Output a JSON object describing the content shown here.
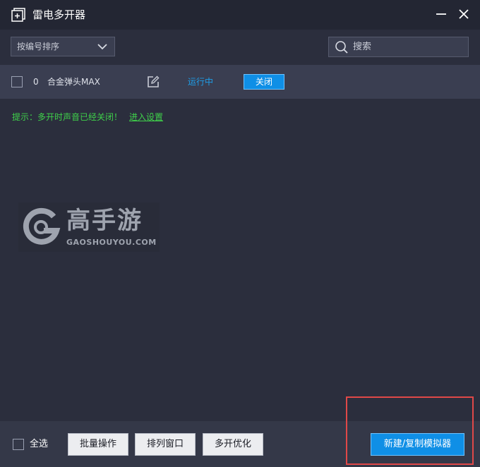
{
  "window": {
    "title": "雷电多开器",
    "icons": {
      "app": "new-window-icon",
      "minimize": "minimize-icon",
      "close": "close-icon"
    }
  },
  "toolbar": {
    "sort_select": {
      "value": "按编号排序",
      "icon": "chevron-down-icon"
    },
    "search": {
      "placeholder": "搜索",
      "icon": "search-icon"
    }
  },
  "instances": [
    {
      "index": "0",
      "name": "合金弹头MAX",
      "status": "运行中",
      "action_label": "关闭",
      "edit_icon": "edit-icon"
    }
  ],
  "hint": {
    "text": "提示：多开时声音已经关闭！",
    "link": "进入设置"
  },
  "watermark": {
    "cn": "高手游",
    "en": "GAOSHOUYOU.COM"
  },
  "footer": {
    "select_all": "全选",
    "batch_button": "批量操作",
    "arrange_button": "排列窗口",
    "optimize_button": "多开优化",
    "new_button": "新建/复制模拟器"
  },
  "colors": {
    "background": "#2b2e3d",
    "title_bar": "#232633",
    "row": "#3a3e51",
    "accent_blue": "#0f8fe6",
    "status_blue": "#1e9ee8",
    "hint_green": "#3fd14a",
    "highlight_red": "#e04848"
  }
}
